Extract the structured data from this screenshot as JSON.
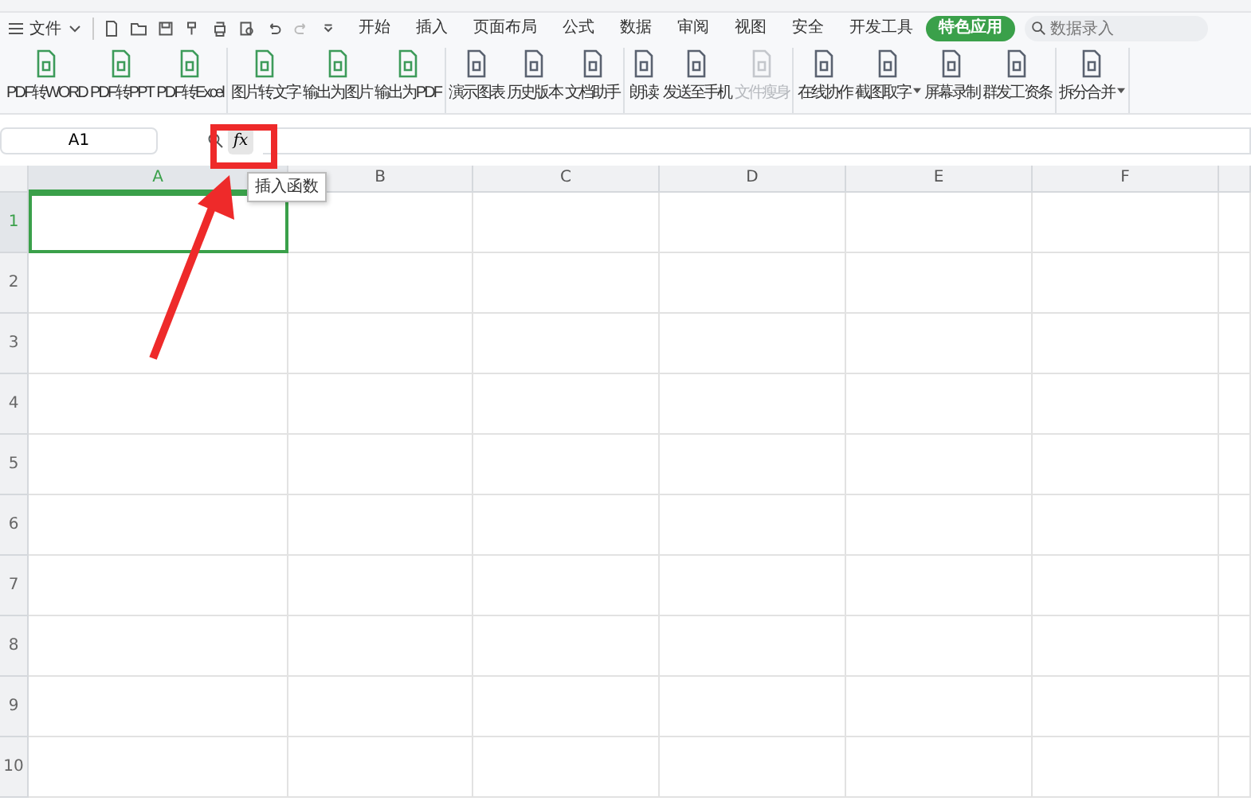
{
  "menu": {
    "file": "文件",
    "tabs": [
      {
        "label": "开始",
        "selected": false
      },
      {
        "label": "插入",
        "selected": false
      },
      {
        "label": "页面布局",
        "selected": false
      },
      {
        "label": "公式",
        "selected": false
      },
      {
        "label": "数据",
        "selected": false
      },
      {
        "label": "审阅",
        "selected": false
      },
      {
        "label": "视图",
        "selected": false
      },
      {
        "label": "安全",
        "selected": false
      },
      {
        "label": "开发工具",
        "selected": false
      },
      {
        "label": "特色应用",
        "selected": true
      }
    ],
    "search": {
      "placeholder": "数据录入"
    }
  },
  "ribbon": [
    [
      {
        "label": "PDF转WORD",
        "disabled": false,
        "dropdown": false
      },
      {
        "label": "PDF转PPT",
        "disabled": false,
        "dropdown": false
      },
      {
        "label": "PDF转Excel",
        "disabled": false,
        "dropdown": false
      }
    ],
    [
      {
        "label": "图片转文字",
        "disabled": false,
        "dropdown": false
      },
      {
        "label": "输出为图片",
        "disabled": false,
        "dropdown": false
      },
      {
        "label": "输出为PDF",
        "disabled": false,
        "dropdown": false
      }
    ],
    [
      {
        "label": "演示图表",
        "disabled": false,
        "dropdown": false
      },
      {
        "label": "历史版本",
        "disabled": false,
        "dropdown": false
      },
      {
        "label": "文档助手",
        "disabled": false,
        "dropdown": false
      }
    ],
    [
      {
        "label": "朗读",
        "disabled": false,
        "dropdown": false
      },
      {
        "label": "发送至手机",
        "disabled": false,
        "dropdown": false
      },
      {
        "label": "文件瘦身",
        "disabled": true,
        "dropdown": false
      }
    ],
    [
      {
        "label": "在线协作",
        "disabled": false,
        "dropdown": false
      },
      {
        "label": "截图取字",
        "disabled": false,
        "dropdown": true
      },
      {
        "label": "屏幕录制",
        "disabled": false,
        "dropdown": false
      },
      {
        "label": "群发工资条",
        "disabled": false,
        "dropdown": false
      }
    ],
    [
      {
        "label": "拆分合并",
        "disabled": false,
        "dropdown": true
      }
    ]
  ],
  "formula_bar": {
    "name_box": "A1",
    "fx": "fx",
    "tooltip": "插入函数"
  },
  "sheet": {
    "columns": [
      {
        "label": "A",
        "selected": true
      },
      {
        "label": "B",
        "selected": false
      },
      {
        "label": "C",
        "selected": false
      },
      {
        "label": "D",
        "selected": false
      },
      {
        "label": "E",
        "selected": false
      },
      {
        "label": "F",
        "selected": false
      }
    ],
    "rows": [
      {
        "label": "1",
        "selected": true
      },
      {
        "label": "2",
        "selected": false
      },
      {
        "label": "3",
        "selected": false
      },
      {
        "label": "4",
        "selected": false
      },
      {
        "label": "5",
        "selected": false
      },
      {
        "label": "6",
        "selected": false
      },
      {
        "label": "7",
        "selected": false
      },
      {
        "label": "8",
        "selected": false
      },
      {
        "label": "9",
        "selected": false
      },
      {
        "label": "10",
        "selected": false
      }
    ]
  }
}
